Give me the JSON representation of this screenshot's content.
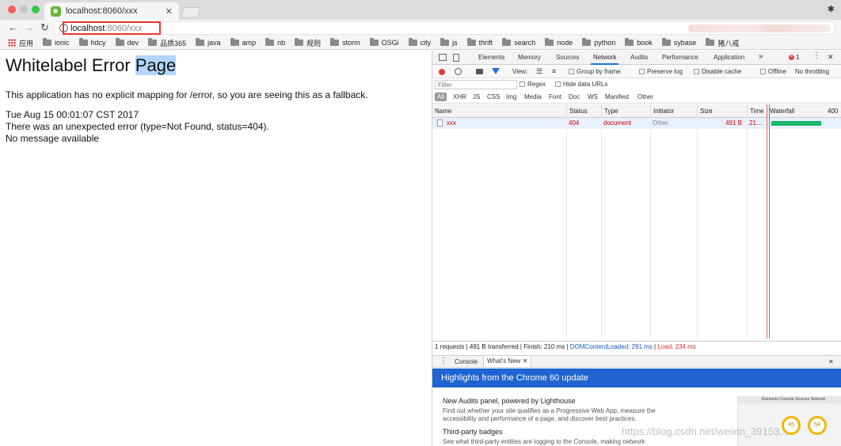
{
  "browser": {
    "tab_title": "localhost:8060/xxx",
    "url_host": "localhost",
    "url_rest": ":8060/xxx"
  },
  "bookmarks": [
    {
      "label": "应用",
      "icon": "apps-grid-icon"
    },
    {
      "label": "ionic",
      "icon": "folder-icon"
    },
    {
      "label": "hdcy",
      "icon": "folder-icon"
    },
    {
      "label": "dev",
      "icon": "folder-icon"
    },
    {
      "label": "品质365",
      "icon": "folder-icon"
    },
    {
      "label": "java",
      "icon": "folder-icon"
    },
    {
      "label": "amp",
      "icon": "folder-icon"
    },
    {
      "label": "nb",
      "icon": "folder-icon"
    },
    {
      "label": "规则",
      "icon": "folder-icon"
    },
    {
      "label": "storm",
      "icon": "folder-icon"
    },
    {
      "label": "OSGi",
      "icon": "folder-icon"
    },
    {
      "label": "city",
      "icon": "folder-icon"
    },
    {
      "label": "js",
      "icon": "folder-icon"
    },
    {
      "label": "thrift",
      "icon": "folder-icon"
    },
    {
      "label": "search",
      "icon": "folder-icon"
    },
    {
      "label": "node",
      "icon": "folder-icon"
    },
    {
      "label": "python",
      "icon": "folder-icon"
    },
    {
      "label": "book",
      "icon": "folder-icon"
    },
    {
      "label": "sybase",
      "icon": "folder-icon"
    },
    {
      "label": "猪八戒",
      "icon": "folder-icon"
    }
  ],
  "page": {
    "title_main": "Whitelabel Error ",
    "title_selected": "Page",
    "line1": "This application has no explicit mapping for /error, so you are seeing this as a fallback.",
    "line2": "Tue Aug 15 00:01:07 CST 2017",
    "line3": "There was an unexpected error (type=Not Found, status=404).",
    "line4": "No message available"
  },
  "devtools": {
    "tabs": [
      "Elements",
      "Memory",
      "Sources",
      "Network",
      "Audits",
      "Performance",
      "Application"
    ],
    "active_tab": "Network",
    "more": "»",
    "error_count": "1",
    "toolbar": {
      "view_label": "View:",
      "group_by_frame": "Group by frame",
      "preserve_log": "Preserve log",
      "disable_cache": "Disable cache",
      "offline": "Offline",
      "throttling": "No throttling"
    },
    "filter": {
      "placeholder": "Filter",
      "regex": "Regex",
      "hide_data_urls": "Hide data URLs"
    },
    "types": [
      "All",
      "XHR",
      "JS",
      "CSS",
      "Img",
      "Media",
      "Font",
      "Doc",
      "WS",
      "Manifest",
      "Other"
    ],
    "columns": [
      "Name",
      "Status",
      "Type",
      "Initiator",
      "Size",
      "Time",
      "Waterfall"
    ],
    "waterfall_tick": "400",
    "rows": [
      {
        "name": "xxx",
        "status": "404",
        "type": "document",
        "initiator": "Other",
        "size": "491 B",
        "time": "21..."
      }
    ],
    "summary": {
      "main": "1 requests | 491 B transferred | Finish: 210 ms | ",
      "dcl": "DOMContentLoaded: 291 ms",
      "sep": " | ",
      "load": "Load: 234 ms"
    },
    "drawer": {
      "tabs": [
        "Console",
        "What's New"
      ],
      "banner": "Highlights from the Chrome 60 update",
      "item1_title": "New Audits panel, powered by Lighthouse",
      "item1_desc1": "Find out whether your site qualifies as a Progressive Web App, measure the",
      "item1_desc2": "accessibility and performance of a page, and discover best practices.",
      "item2_title": "Third-party badges",
      "item2_desc": "See what third-party entities are logging to the Console, making network",
      "thumb_tabs": "Elements   Console   Sources   Network",
      "score1": "45",
      "score2": "54"
    }
  },
  "watermark": "https://blog.csdn.net/weixin_39153...",
  "colors": {
    "accent": "#1a73e8",
    "error_red": "#d32f2f",
    "banner": "#1f64d0",
    "waterfall": "#1bb56b"
  }
}
